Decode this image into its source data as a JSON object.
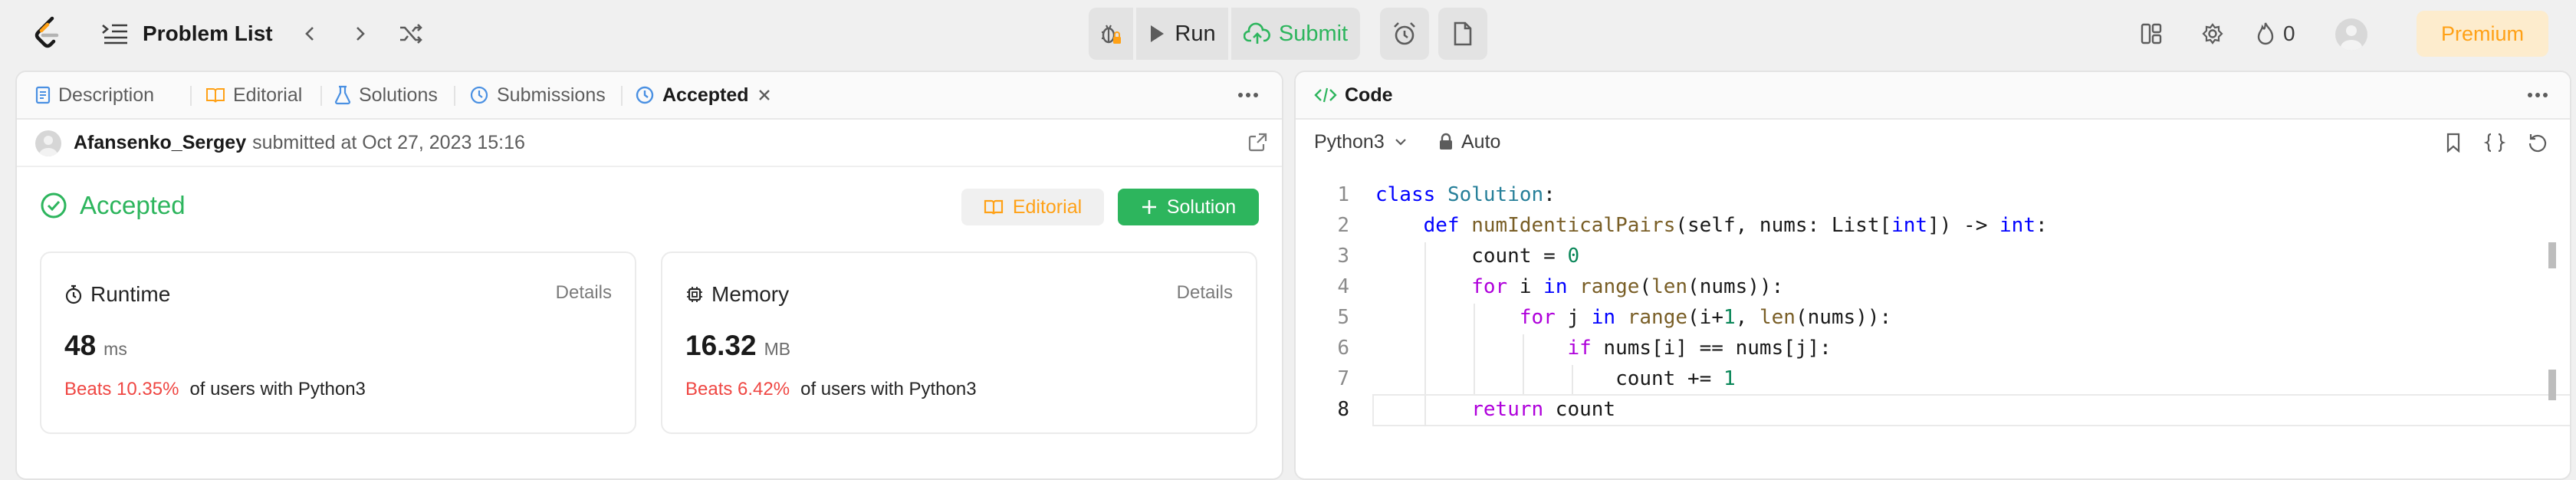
{
  "topbar": {
    "problem_list_label": "Problem List",
    "run_label": "Run",
    "submit_label": "Submit",
    "streak_count": "0",
    "premium_label": "Premium",
    "brand_color": "#ffa116",
    "accent_green": "#2db55d"
  },
  "left_panel": {
    "tabs": [
      "Description",
      "Editorial",
      "Solutions",
      "Submissions",
      "Accepted"
    ],
    "submission": {
      "username": "Afansenko_Sergey",
      "submitted_text": "submitted at Oct 27, 2023 15:16"
    },
    "status": "Accepted",
    "editorial_button": "Editorial",
    "solution_button": "Solution",
    "runtime": {
      "title": "Runtime",
      "details": "Details",
      "value": "48",
      "unit": "ms",
      "beats": "Beats 10.35%",
      "beats_suffix": "of users with Python3"
    },
    "memory": {
      "title": "Memory",
      "details": "Details",
      "value": "16.32",
      "unit": "MB",
      "beats": "Beats 6.42%",
      "beats_suffix": "of users with Python3"
    }
  },
  "right_panel": {
    "title": "Code",
    "language": "Python3",
    "mode": "Auto",
    "current_line": 8,
    "line_numbers": [
      "1",
      "2",
      "3",
      "4",
      "5",
      "6",
      "7",
      "8"
    ],
    "code_lines": [
      "class Solution:",
      "    def numIdenticalPairs(self, nums: List[int]) -> int:",
      "        count = 0",
      "        for i in range(len(nums)):",
      "            for j in range(i+1, len(nums)):",
      "                if nums[i] == nums[j]:",
      "                    count += 1",
      "        return count"
    ]
  }
}
